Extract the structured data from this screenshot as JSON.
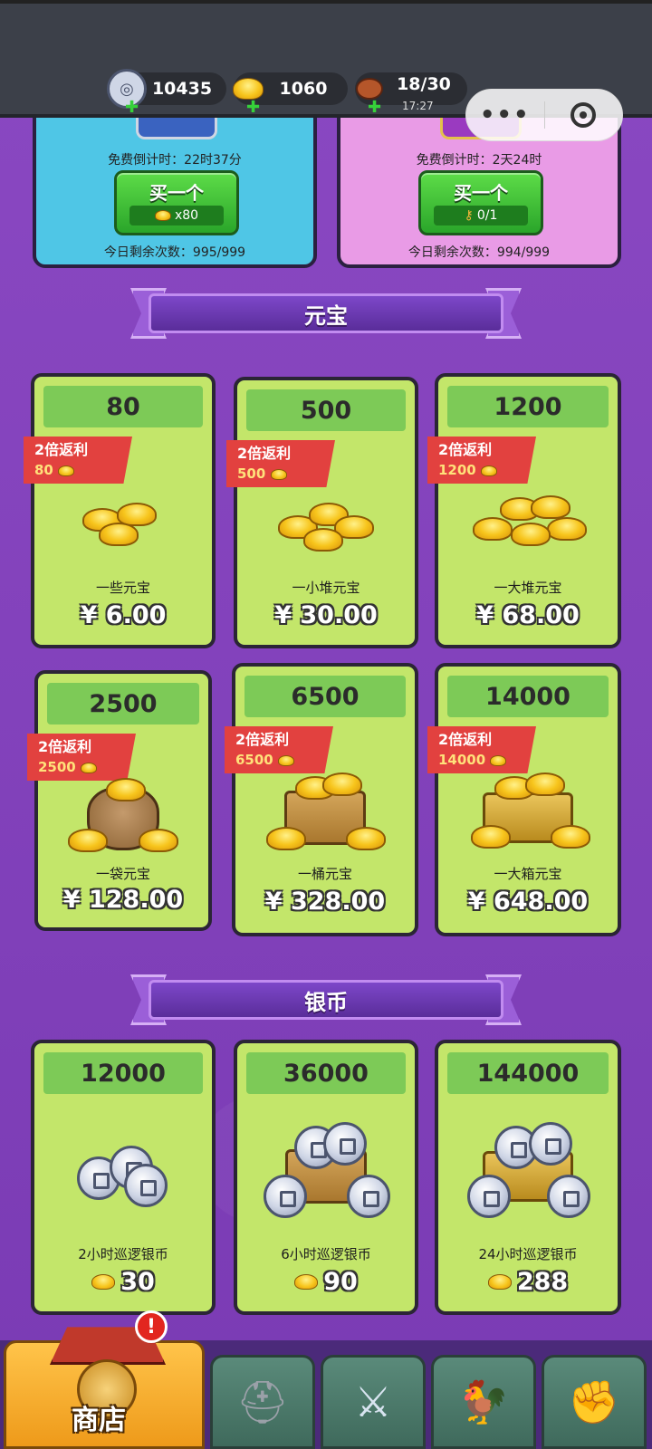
{
  "resources": {
    "silver": {
      "value": "10435",
      "icon": "silver-coin-icon"
    },
    "gold": {
      "value": "1060",
      "icon": "gold-ingot-icon"
    },
    "stamina": {
      "value": "18/30",
      "timer": "17:27",
      "icon": "meat-icon"
    }
  },
  "chests": [
    {
      "timer": "免费倒计时：22时37分",
      "button": "买一个",
      "cost": "x80",
      "remaining": "今日剩余次数：995/999"
    },
    {
      "timer": "免费倒计时：2天24时",
      "button": "买一个",
      "cost": "0/1",
      "remaining": "今日剩余次数：994/999"
    }
  ],
  "sections": {
    "ingot_title": "元宝",
    "silver_title": "银币"
  },
  "ingot_items": [
    {
      "amount": "80",
      "bonus_label": "2倍返利",
      "bonus_value": "80",
      "name": "一些元宝",
      "price": "¥ 6.00"
    },
    {
      "amount": "500",
      "bonus_label": "2倍返利",
      "bonus_value": "500",
      "name": "一小堆元宝",
      "price": "¥ 30.00"
    },
    {
      "amount": "1200",
      "bonus_label": "2倍返利",
      "bonus_value": "1200",
      "name": "一大堆元宝",
      "price": "¥ 68.00"
    },
    {
      "amount": "2500",
      "bonus_label": "2倍返利",
      "bonus_value": "2500",
      "name": "一袋元宝",
      "price": "¥ 128.00"
    },
    {
      "amount": "6500",
      "bonus_label": "2倍返利",
      "bonus_value": "6500",
      "name": "一桶元宝",
      "price": "¥ 328.00"
    },
    {
      "amount": "14000",
      "bonus_label": "2倍返利",
      "bonus_value": "14000",
      "name": "一大箱元宝",
      "price": "¥ 648.00"
    }
  ],
  "silver_items": [
    {
      "amount": "12000",
      "name": "2小时巡逻银币",
      "cost": "30"
    },
    {
      "amount": "36000",
      "name": "6小时巡逻银币",
      "cost": "90"
    },
    {
      "amount": "144000",
      "name": "24小时巡逻银币",
      "cost": "288"
    }
  ],
  "nav": {
    "shop_label": "商店",
    "alert": "!",
    "tabs": [
      "shop",
      "helmet",
      "swords",
      "rooster",
      "fist"
    ]
  }
}
